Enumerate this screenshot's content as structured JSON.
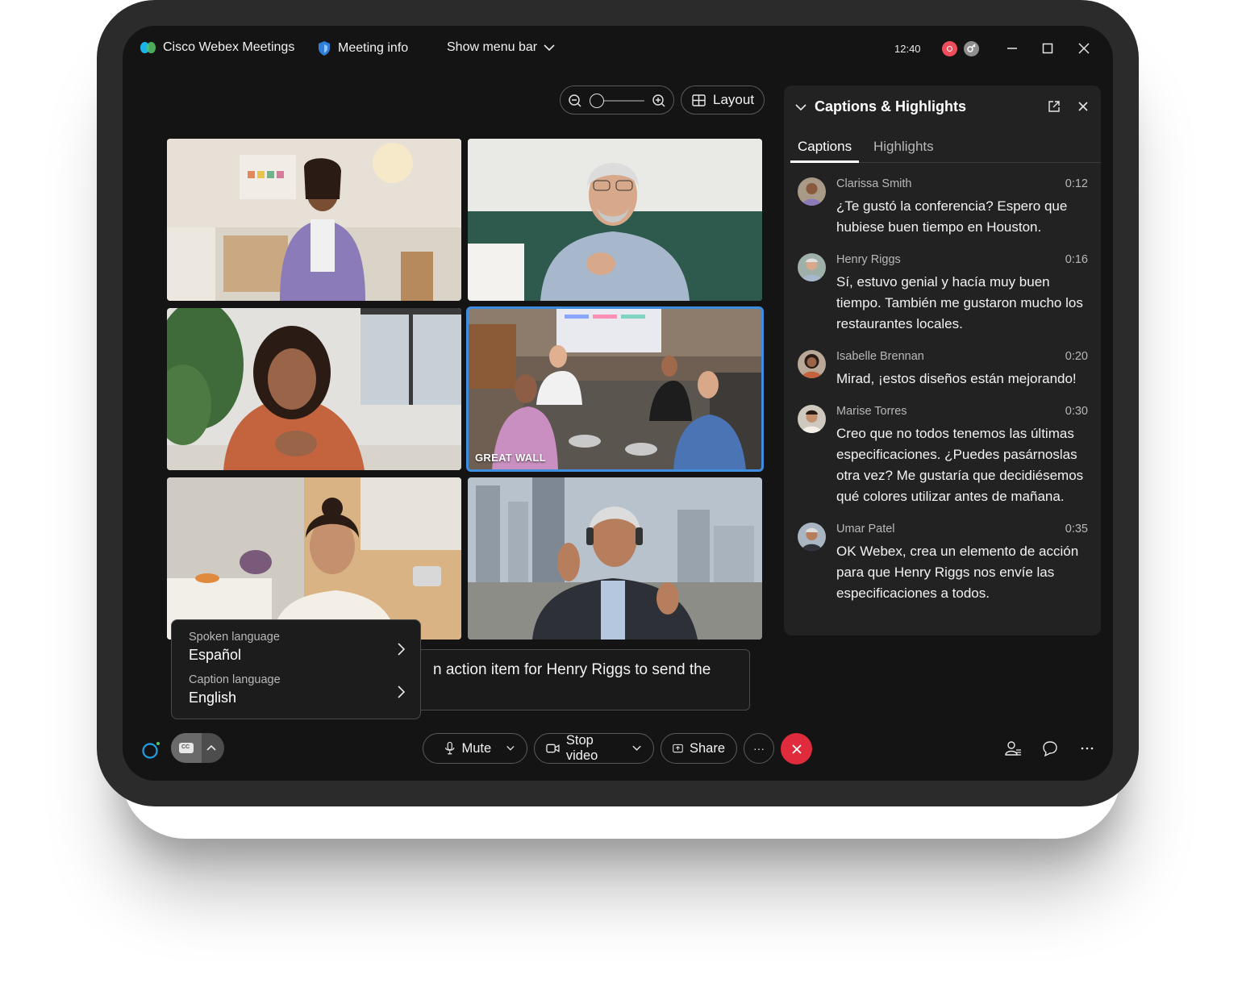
{
  "titlebar": {
    "app_name": "Cisco Webex Meetings",
    "meeting_info": "Meeting info",
    "show_menu_bar": "Show menu bar",
    "time": "12:40"
  },
  "toolbar_top": {
    "layout_label": "Layout"
  },
  "video_grid": {
    "tiles": [
      {
        "label": ""
      },
      {
        "label": ""
      },
      {
        "label": ""
      },
      {
        "label": "GREAT WALL"
      },
      {
        "label": ""
      },
      {
        "label": ""
      }
    ]
  },
  "caption_bar": {
    "text": "n action item for Henry Riggs to send the"
  },
  "language_menu": {
    "spoken_label": "Spoken language",
    "spoken_value": "Español",
    "caption_label": "Caption language",
    "caption_value": "English"
  },
  "bottom_toolbar": {
    "mute_label": "Mute",
    "stop_video_label": "Stop video",
    "share_label": "Share",
    "more_label": "···"
  },
  "panel": {
    "title": "Captions & Highlights",
    "tabs": [
      "Captions",
      "Highlights"
    ],
    "messages": [
      {
        "name": "Clarissa Smith",
        "time": "0:12",
        "text": "¿Te gustó la conferencia? Espero que hubiese buen tiempo en Houston."
      },
      {
        "name": "Henry Riggs",
        "time": "0:16",
        "text": "Sí, estuvo genial y hacía muy buen tiempo. También me gustaron mucho los restaurantes locales."
      },
      {
        "name": "Isabelle Brennan",
        "time": "0:20",
        "text": "Mirad, ¡estos diseños están mejorando!"
      },
      {
        "name": "Marise Torres",
        "time": "0:30",
        "text": "Creo que no todos tenemos las últimas especificaciones. ¿Puedes pasárnoslas otra vez? Me gustaría que decidiésemos qué colores utilizar antes de mañana."
      },
      {
        "name": "Umar Patel",
        "time": "0:35",
        "text": "OK Webex, crea un elemento de acción para que Henry Riggs nos envíe las especificaciones a todos."
      }
    ]
  },
  "colors": {
    "accent": "#3d8de0",
    "end_call": "#e02b3c",
    "recording": "#f04d5c"
  }
}
